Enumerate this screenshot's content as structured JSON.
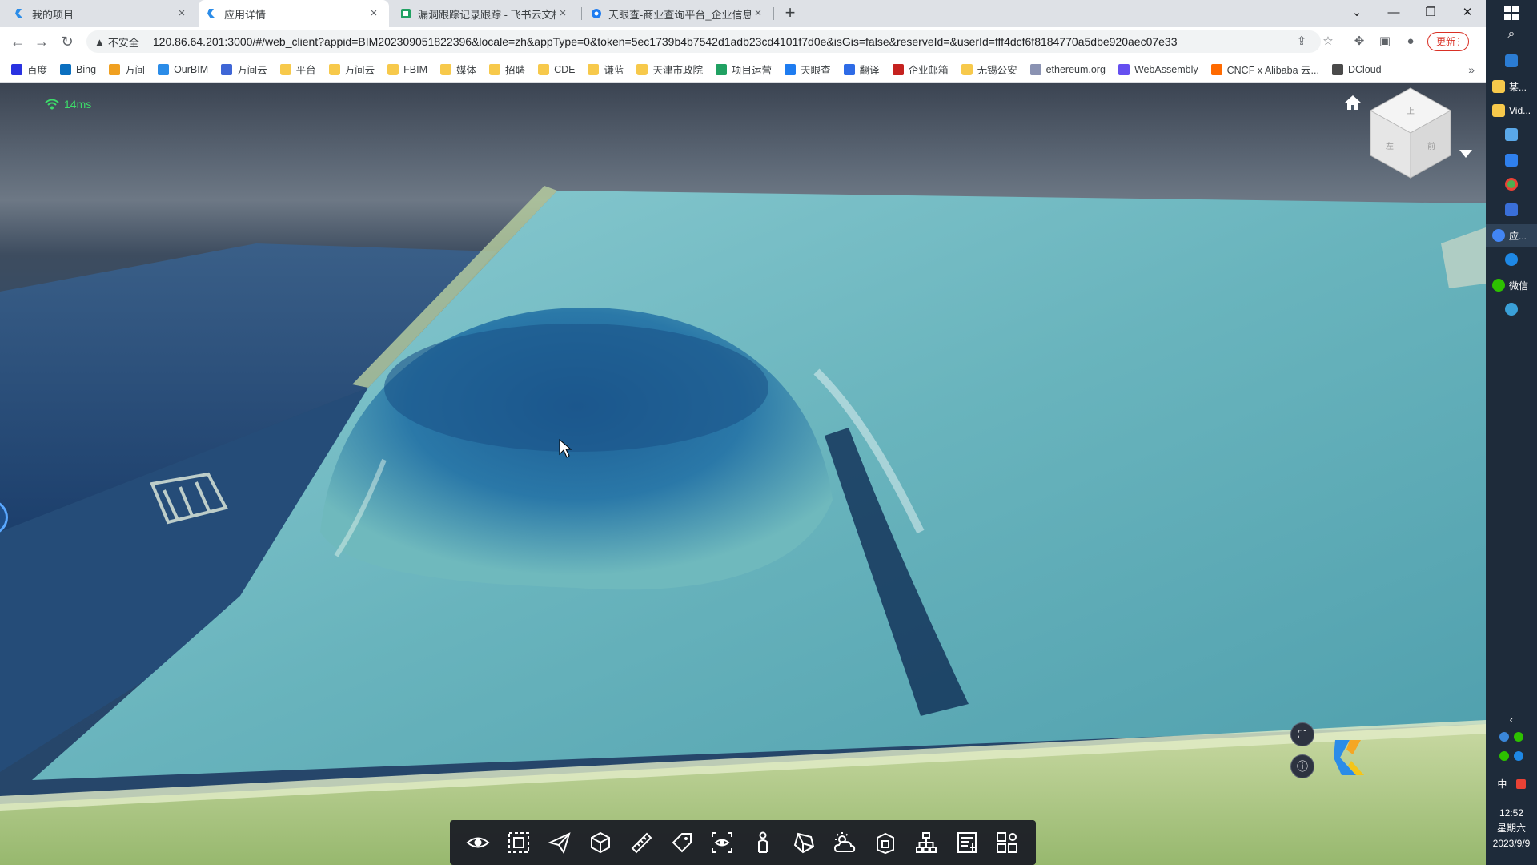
{
  "browser": {
    "tabs": [
      {
        "title": "我的项目",
        "close": "×",
        "active": false
      },
      {
        "title": "应用详情",
        "close": "×",
        "active": true
      },
      {
        "title": "漏洞跟踪记录跟踪 - 飞书云文档",
        "close": "×",
        "active": false
      },
      {
        "title": "天眼查-商业查询平台_企业信息查询",
        "close": "×",
        "active": false
      }
    ],
    "new_tab": "+",
    "window_controls": {
      "dropdown": "⌄",
      "minimize": "—",
      "restore": "❐",
      "close": "✕"
    },
    "address": {
      "security_label": "不安全",
      "url": "120.86.64.201:3000/#/web_client?appid=BIM202309051822396&locale=zh&appType=0&token=5ec1739b4b7542d1adb23cd4101f7d0e&isGis=false&reserveId=&userId=fff4dcf6f8184770a5dbe920aec07e33"
    },
    "update_button": "更新",
    "bookmarks": [
      {
        "label": "百度",
        "icon": "baidu-icon",
        "color": "#2932e1"
      },
      {
        "label": "Bing",
        "icon": "search-icon",
        "color": "#0b6fbf"
      },
      {
        "label": "万间",
        "icon": "wanjian-icon",
        "color": "#f0a020"
      },
      {
        "label": "OurBIM",
        "icon": "ourbim-icon",
        "color": "#2b8ce8"
      },
      {
        "label": "万间云",
        "icon": "vj-icon",
        "color": "#3f66d6"
      },
      {
        "label": "平台",
        "icon": "folder-icon",
        "color": "#f7c94b"
      },
      {
        "label": "万间云",
        "icon": "folder-icon",
        "color": "#f7c94b"
      },
      {
        "label": "FBIM",
        "icon": "folder-icon",
        "color": "#f7c94b"
      },
      {
        "label": "媒体",
        "icon": "folder-icon",
        "color": "#f7c94b"
      },
      {
        "label": "招聘",
        "icon": "folder-icon",
        "color": "#f7c94b"
      },
      {
        "label": "CDE",
        "icon": "folder-icon",
        "color": "#f7c94b"
      },
      {
        "label": "谦蓝",
        "icon": "folder-icon",
        "color": "#f7c94b"
      },
      {
        "label": "天津市政院",
        "icon": "folder-icon",
        "color": "#f7c94b"
      },
      {
        "label": "项目运营",
        "icon": "sheet-icon",
        "color": "#20a162"
      },
      {
        "label": "天眼查",
        "icon": "tianyancha-icon",
        "color": "#1e7cf0"
      },
      {
        "label": "翻译",
        "icon": "translate-icon",
        "color": "#2e6be6"
      },
      {
        "label": "企业邮箱",
        "icon": "mail-icon",
        "color": "#c5221f"
      },
      {
        "label": "无锡公安",
        "icon": "folder-icon",
        "color": "#f7c94b"
      },
      {
        "label": "ethereum.org",
        "icon": "ethereum-icon",
        "color": "#8a92b2"
      },
      {
        "label": "WebAssembly",
        "icon": "webassembly-icon",
        "color": "#654ff0"
      },
      {
        "label": "CNCF x Alibaba 云...",
        "icon": "alibaba-icon",
        "color": "#ff6a00"
      },
      {
        "label": "DCloud",
        "icon": "dcloud-icon",
        "color": "#4a4a4a"
      }
    ],
    "bookmarks_more": "»"
  },
  "viewer": {
    "latency": "14ms",
    "toolbar": [
      {
        "name": "visibility-tool",
        "icon": "eye-icon"
      },
      {
        "name": "frame-select-tool",
        "icon": "frame-select-icon"
      },
      {
        "name": "roam-tool",
        "icon": "paper-plane-icon"
      },
      {
        "name": "section-box-tool",
        "icon": "section-cube-icon"
      },
      {
        "name": "measure-tool",
        "icon": "ruler-icon"
      },
      {
        "name": "tag-tool",
        "icon": "tag-icon"
      },
      {
        "name": "viewpoint-tool",
        "icon": "viewpoint-eye-icon"
      },
      {
        "name": "walk-tool",
        "icon": "person-icon"
      },
      {
        "name": "material-tool",
        "icon": "prism-icon"
      },
      {
        "name": "weather-tool",
        "icon": "sun-cloud-icon"
      },
      {
        "name": "explode-tool",
        "icon": "explode-box-icon"
      },
      {
        "name": "structure-tree-tool",
        "icon": "hierarchy-icon"
      },
      {
        "name": "properties-tool",
        "icon": "properties-panel-icon"
      },
      {
        "name": "more-tools",
        "icon": "grid-location-icon"
      }
    ],
    "fullscreen_icon": "fullscreen-icon",
    "info_icon": "info-icon",
    "colors": {
      "latency": "#3ddc6a",
      "water_light": "#7fc3c4",
      "water_deep": "#1f6fa6",
      "toolbar_bg": "#191c24"
    }
  },
  "taskbar": {
    "items": [
      {
        "label": "某...",
        "icon": "folder-icon",
        "color": "#f7c94b",
        "active": false
      },
      {
        "label": "Vid...",
        "icon": "folder-icon",
        "color": "#f7c94b",
        "active": false
      },
      {
        "label": "应...",
        "icon": "chrome-icon",
        "color": "#4285f4",
        "active": true
      },
      {
        "label": "微信",
        "icon": "wechat-icon",
        "color": "#2dc100",
        "active": false
      }
    ],
    "input_method": "中",
    "time": "12:52",
    "weekday": "星期六",
    "date": "2023/9/9"
  }
}
